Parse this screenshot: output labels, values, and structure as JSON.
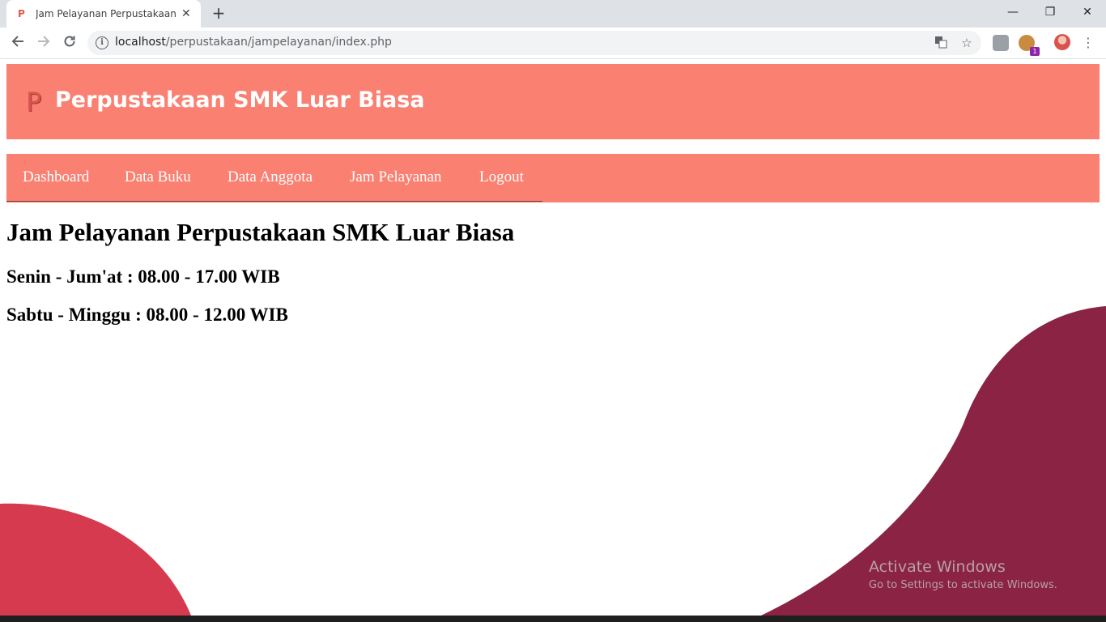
{
  "browser": {
    "tab_title": "Jam Pelayanan Perpustakaan SMK Luar Biasa",
    "tab_favicon": "P",
    "url_host": "localhost",
    "url_path": "/perpustakaan/jampelayanan/index.php",
    "extension_badge": "1",
    "icons": [
      "back-arrow-icon",
      "forward-arrow-icon",
      "reload-icon",
      "info-icon",
      "translate-icon",
      "star-icon",
      "menu-dots-icon"
    ]
  },
  "site": {
    "logo_letter": "P",
    "title": "Perpustakaan SMK Luar Biasa",
    "nav": [
      "Dashboard",
      "Data Buku",
      "Data Anggota",
      "Jam Pelayanan",
      "Logout"
    ]
  },
  "main": {
    "heading": "Jam Pelayanan Perpustakaan SMK Luar Biasa",
    "hours": [
      "Senin - Jum'at : 08.00 - 17.00 WIB",
      "Sabtu - Minggu : 08.00 - 12.00 WIB"
    ]
  },
  "watermark": {
    "line1": "Activate Windows",
    "line2": "Go to Settings to activate Windows."
  },
  "colors": {
    "header_bg": "#fa8072",
    "blob_left": "#d63a4e",
    "blob_right": "#8b2344"
  }
}
